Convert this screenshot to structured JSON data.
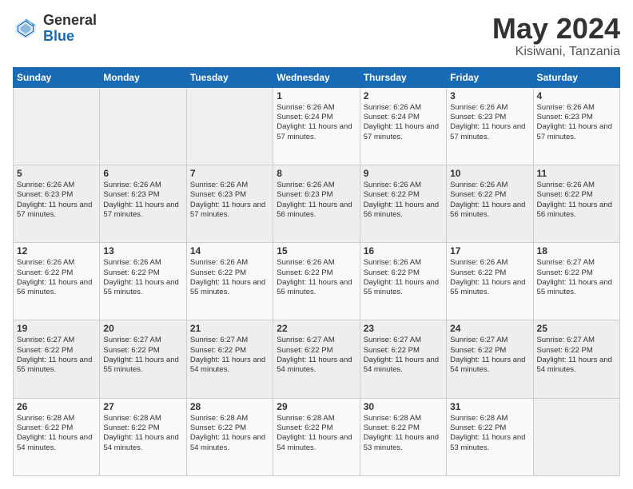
{
  "header": {
    "logo_general": "General",
    "logo_blue": "Blue",
    "title": "May 2024",
    "location": "Kisiwani, Tanzania"
  },
  "weekdays": [
    "Sunday",
    "Monday",
    "Tuesday",
    "Wednesday",
    "Thursday",
    "Friday",
    "Saturday"
  ],
  "weeks": [
    [
      {
        "day": "",
        "sunrise": "",
        "sunset": "",
        "daylight": ""
      },
      {
        "day": "",
        "sunrise": "",
        "sunset": "",
        "daylight": ""
      },
      {
        "day": "",
        "sunrise": "",
        "sunset": "",
        "daylight": ""
      },
      {
        "day": "1",
        "sunrise": "Sunrise: 6:26 AM",
        "sunset": "Sunset: 6:24 PM",
        "daylight": "Daylight: 11 hours and 57 minutes."
      },
      {
        "day": "2",
        "sunrise": "Sunrise: 6:26 AM",
        "sunset": "Sunset: 6:24 PM",
        "daylight": "Daylight: 11 hours and 57 minutes."
      },
      {
        "day": "3",
        "sunrise": "Sunrise: 6:26 AM",
        "sunset": "Sunset: 6:23 PM",
        "daylight": "Daylight: 11 hours and 57 minutes."
      },
      {
        "day": "4",
        "sunrise": "Sunrise: 6:26 AM",
        "sunset": "Sunset: 6:23 PM",
        "daylight": "Daylight: 11 hours and 57 minutes."
      }
    ],
    [
      {
        "day": "5",
        "sunrise": "Sunrise: 6:26 AM",
        "sunset": "Sunset: 6:23 PM",
        "daylight": "Daylight: 11 hours and 57 minutes."
      },
      {
        "day": "6",
        "sunrise": "Sunrise: 6:26 AM",
        "sunset": "Sunset: 6:23 PM",
        "daylight": "Daylight: 11 hours and 57 minutes."
      },
      {
        "day": "7",
        "sunrise": "Sunrise: 6:26 AM",
        "sunset": "Sunset: 6:23 PM",
        "daylight": "Daylight: 11 hours and 57 minutes."
      },
      {
        "day": "8",
        "sunrise": "Sunrise: 6:26 AM",
        "sunset": "Sunset: 6:23 PM",
        "daylight": "Daylight: 11 hours and 56 minutes."
      },
      {
        "day": "9",
        "sunrise": "Sunrise: 6:26 AM",
        "sunset": "Sunset: 6:22 PM",
        "daylight": "Daylight: 11 hours and 56 minutes."
      },
      {
        "day": "10",
        "sunrise": "Sunrise: 6:26 AM",
        "sunset": "Sunset: 6:22 PM",
        "daylight": "Daylight: 11 hours and 56 minutes."
      },
      {
        "day": "11",
        "sunrise": "Sunrise: 6:26 AM",
        "sunset": "Sunset: 6:22 PM",
        "daylight": "Daylight: 11 hours and 56 minutes."
      }
    ],
    [
      {
        "day": "12",
        "sunrise": "Sunrise: 6:26 AM",
        "sunset": "Sunset: 6:22 PM",
        "daylight": "Daylight: 11 hours and 56 minutes."
      },
      {
        "day": "13",
        "sunrise": "Sunrise: 6:26 AM",
        "sunset": "Sunset: 6:22 PM",
        "daylight": "Daylight: 11 hours and 55 minutes."
      },
      {
        "day": "14",
        "sunrise": "Sunrise: 6:26 AM",
        "sunset": "Sunset: 6:22 PM",
        "daylight": "Daylight: 11 hours and 55 minutes."
      },
      {
        "day": "15",
        "sunrise": "Sunrise: 6:26 AM",
        "sunset": "Sunset: 6:22 PM",
        "daylight": "Daylight: 11 hours and 55 minutes."
      },
      {
        "day": "16",
        "sunrise": "Sunrise: 6:26 AM",
        "sunset": "Sunset: 6:22 PM",
        "daylight": "Daylight: 11 hours and 55 minutes."
      },
      {
        "day": "17",
        "sunrise": "Sunrise: 6:26 AM",
        "sunset": "Sunset: 6:22 PM",
        "daylight": "Daylight: 11 hours and 55 minutes."
      },
      {
        "day": "18",
        "sunrise": "Sunrise: 6:27 AM",
        "sunset": "Sunset: 6:22 PM",
        "daylight": "Daylight: 11 hours and 55 minutes."
      }
    ],
    [
      {
        "day": "19",
        "sunrise": "Sunrise: 6:27 AM",
        "sunset": "Sunset: 6:22 PM",
        "daylight": "Daylight: 11 hours and 55 minutes."
      },
      {
        "day": "20",
        "sunrise": "Sunrise: 6:27 AM",
        "sunset": "Sunset: 6:22 PM",
        "daylight": "Daylight: 11 hours and 55 minutes."
      },
      {
        "day": "21",
        "sunrise": "Sunrise: 6:27 AM",
        "sunset": "Sunset: 6:22 PM",
        "daylight": "Daylight: 11 hours and 54 minutes."
      },
      {
        "day": "22",
        "sunrise": "Sunrise: 6:27 AM",
        "sunset": "Sunset: 6:22 PM",
        "daylight": "Daylight: 11 hours and 54 minutes."
      },
      {
        "day": "23",
        "sunrise": "Sunrise: 6:27 AM",
        "sunset": "Sunset: 6:22 PM",
        "daylight": "Daylight: 11 hours and 54 minutes."
      },
      {
        "day": "24",
        "sunrise": "Sunrise: 6:27 AM",
        "sunset": "Sunset: 6:22 PM",
        "daylight": "Daylight: 11 hours and 54 minutes."
      },
      {
        "day": "25",
        "sunrise": "Sunrise: 6:27 AM",
        "sunset": "Sunset: 6:22 PM",
        "daylight": "Daylight: 11 hours and 54 minutes."
      }
    ],
    [
      {
        "day": "26",
        "sunrise": "Sunrise: 6:28 AM",
        "sunset": "Sunset: 6:22 PM",
        "daylight": "Daylight: 11 hours and 54 minutes."
      },
      {
        "day": "27",
        "sunrise": "Sunrise: 6:28 AM",
        "sunset": "Sunset: 6:22 PM",
        "daylight": "Daylight: 11 hours and 54 minutes."
      },
      {
        "day": "28",
        "sunrise": "Sunrise: 6:28 AM",
        "sunset": "Sunset: 6:22 PM",
        "daylight": "Daylight: 11 hours and 54 minutes."
      },
      {
        "day": "29",
        "sunrise": "Sunrise: 6:28 AM",
        "sunset": "Sunset: 6:22 PM",
        "daylight": "Daylight: 11 hours and 54 minutes."
      },
      {
        "day": "30",
        "sunrise": "Sunrise: 6:28 AM",
        "sunset": "Sunset: 6:22 PM",
        "daylight": "Daylight: 11 hours and 53 minutes."
      },
      {
        "day": "31",
        "sunrise": "Sunrise: 6:28 AM",
        "sunset": "Sunset: 6:22 PM",
        "daylight": "Daylight: 11 hours and 53 minutes."
      },
      {
        "day": "",
        "sunrise": "",
        "sunset": "",
        "daylight": ""
      }
    ]
  ]
}
